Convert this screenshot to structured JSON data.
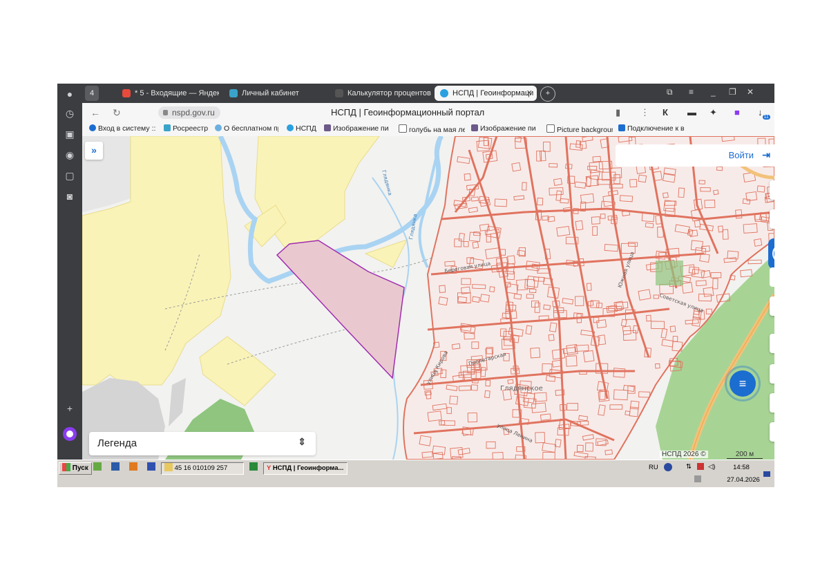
{
  "tabs": [
    {
      "label": "4",
      "icon": "tab-counter-icon"
    },
    {
      "label": "* 5 - Входящие — Яндекс",
      "icon": "mail-icon"
    },
    {
      "label": "Личный кабинет",
      "icon": "rosreestr-icon"
    },
    {
      "label": "Калькулятор процентов",
      "icon": "calculator-icon"
    },
    {
      "label": "НСПД | Геоинформаци",
      "icon": "nspd-icon",
      "active": true
    }
  ],
  "address": {
    "url": "nspd.gov.ru",
    "title": "НСПД | Геоинформационный портал",
    "badge": "11"
  },
  "bookmarks": [
    "Вход в систему ::",
    "Росреестр",
    "О бесплатном пр",
    "НСПД",
    "Изображение пи",
    "голубь на мая ле",
    "Изображение пи",
    "Picture backgroun",
    "Подключение к в"
  ],
  "map": {
    "login_label": "Войти",
    "legend_label": "Легенда",
    "copyright": "НСПД 2026 ©",
    "scale": "200 м",
    "place_label": "Глядянское",
    "street_labels": [
      "Глядянка",
      "Глядянка",
      "улица Кирова",
      "Южная улица",
      "Советская улица",
      "Береговая улица",
      "улица Ленина",
      "Пролетарская"
    ]
  },
  "taskbar": {
    "start": "Пуск",
    "folder": "45 16 010109 257",
    "window": "НСПД | Геоинформа...",
    "lang": "RU",
    "time": "14:58",
    "date": "27.04.2026"
  },
  "colors": {
    "accent": "#1c6dd0",
    "parcel_fill": "#e9c9cf",
    "parcel_stroke": "#a02cb0",
    "cadastre_lines": "#e0735f",
    "yellow_zone": "#faf3b8",
    "river": "#a9d3f2",
    "forest": "#8fc57f"
  }
}
